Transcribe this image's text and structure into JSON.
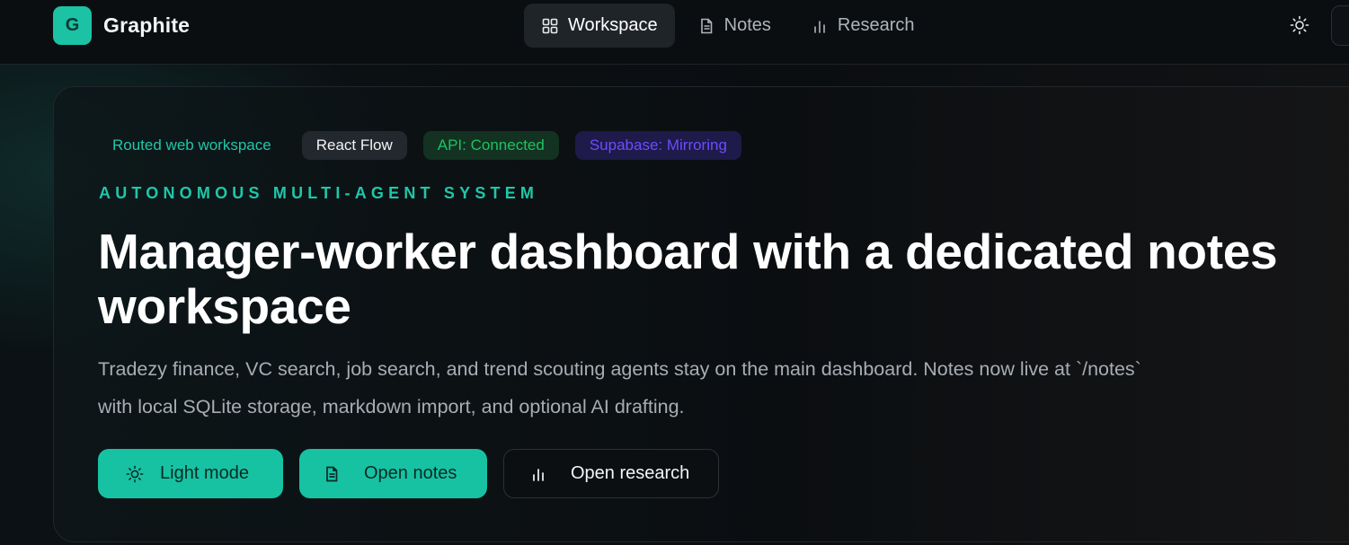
{
  "app": {
    "logo_letter": "G",
    "name": "Graphite"
  },
  "nav": {
    "items": [
      {
        "label": "Workspace",
        "icon": "grid-icon",
        "active": true
      },
      {
        "label": "Notes",
        "icon": "document-icon",
        "active": false
      },
      {
        "label": "Research",
        "icon": "bar-chart-icon",
        "active": false
      }
    ]
  },
  "header": {
    "theme_icon": "sun-icon"
  },
  "hero": {
    "chips": [
      {
        "label": "Routed web workspace"
      },
      {
        "label": "React Flow"
      },
      {
        "label": "API: Connected"
      },
      {
        "label": "Supabase: Mirroring"
      }
    ],
    "eyebrow": "AUTONOMOUS MULTI-AGENT SYSTEM",
    "title": "Manager-worker dashboard with a dedicated notes workspace",
    "description": "Tradezy finance, VC search, job search, and trend scouting agents stay on the main dashboard. Notes now live at `/notes` with local SQLite storage, markdown import, and optional AI drafting.",
    "buttons": {
      "light_mode": "Light mode",
      "open_notes": "Open notes",
      "open_research": "Open research"
    }
  },
  "colors": {
    "accent": "#17c2a3",
    "api_status": "#1fc260",
    "supabase_status": "#6d4cff"
  }
}
